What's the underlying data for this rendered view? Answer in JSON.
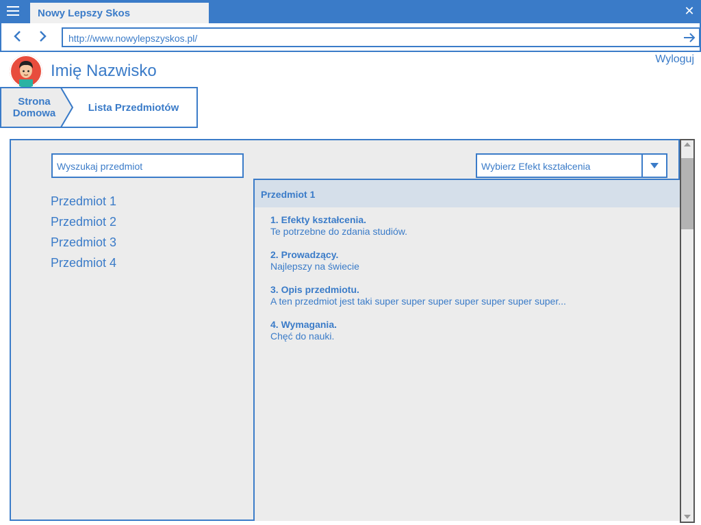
{
  "window": {
    "tab_title": "Nowy Lepszy Skos",
    "url": "http://www.nowylepszyskos.pl/"
  },
  "user": {
    "name": "Imię Nazwisko",
    "logout_label": "Wyloguj"
  },
  "breadcrumb": {
    "items": [
      {
        "label_line1": "Strona",
        "label_line2": "Domowa"
      },
      {
        "label": "Lista Przedmiotów"
      }
    ]
  },
  "search": {
    "placeholder": "Wyszukaj przedmiot"
  },
  "subjects": [
    "Przedmiot 1",
    "Przedmiot 2",
    "Przedmiot 3",
    "Przedmiot 4"
  ],
  "filter": {
    "label": "Wybierz Efekt kształcenia"
  },
  "detail": {
    "title": "Przedmiot 1",
    "sections": [
      {
        "heading": "1. Efekty kształcenia.",
        "body": "Te potrzebne do zdania studiów."
      },
      {
        "heading": "2. Prowadzący.",
        "body": "Najlepszy na świecie"
      },
      {
        "heading": "3. Opis przedmiotu.",
        "body": "A ten przedmiot jest taki super super super super super super super..."
      },
      {
        "heading": "4. Wymagania.",
        "body": "Chęć do nauki."
      }
    ]
  },
  "colors": {
    "accent": "#3a7bc8",
    "panel_bg": "#ececec",
    "detail_header_bg": "#d5dfea",
    "avatar_bg": "#e84c3d"
  },
  "icons": {
    "menu": "hamburger-menu-icon",
    "close": "close-icon",
    "back": "chevron-left-icon",
    "forward": "chevron-right-icon",
    "go": "arrow-right-icon",
    "dropdown": "triangle-down-icon"
  }
}
